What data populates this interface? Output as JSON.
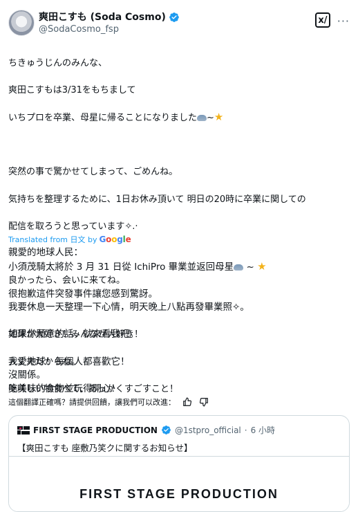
{
  "author": {
    "name": "爽田こすも (Soda Cosmo)",
    "handle": "@SodaCosmo_fsp"
  },
  "header": {
    "grok_label": "x/",
    "more_label": "···"
  },
  "tweet": {
    "lines": [
      "ちきゅうじんのみんな、",
      "爽田こすもは3/31をもちまして",
      "いちプロを卒業、母星に帰ることになりました",
      "",
      "突然の事で驚かせてしまって、ごめんね。",
      "気持ちを整理するために、1日お休み頂いて 明日の20時に卒業に関しての",
      "配信を取ろうと思っています",
      "",
      "良かったら、会いに来てね。",
      "",
      "地球が大好き！みんなが大好き！",
      "大丈夫だからね。",
      "美味しい物食べて、あっかくすごすこと！"
    ],
    "line3_suffix": "~",
    "line7_suffix": "✧.·"
  },
  "translated_label": "Translated from 日文 by",
  "google_label": "Google",
  "translation": {
    "lines": [
      "親愛的地球人民：",
      "小須茂騎太將於 3 月 31 日從 IchiPro 畢業並返回母星",
      "",
      "很抱歉這件突發事件讓您感到驚訝。",
      "我要休息一天整理一下心情，明天晚上八點再發畢業照✧。",
      "",
      "如果你願意的話，就來看我吧。",
      "",
      "我愛地球！每個人都喜歡它！",
      "沒關係。",
      "吃美味的食物並玩得開心！"
    ],
    "line2_suffix": " ~ "
  },
  "feedback": {
    "prompt": "這個翻譯正確嗎？請提供回饋，讓我們可以改進："
  },
  "quote": {
    "author_name": "FIRST STAGE PRODUCTION",
    "handle": "@1stpro_official",
    "separator": "·",
    "time": "6 小時",
    "text": "【爽田こすも 座敷乃笑クに関するお知らせ】",
    "image_text": "FIRST STAGE PRODUCTION"
  },
  "colors": {
    "link": "#1d9bf0",
    "verified": "#1d9bf0",
    "muted": "#536471",
    "star": "#f3b21a"
  }
}
